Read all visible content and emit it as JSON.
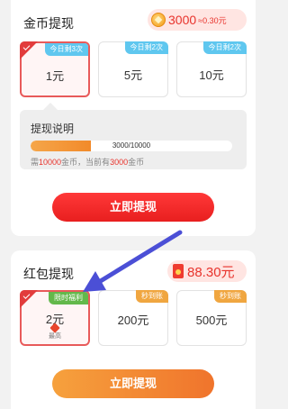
{
  "coin_section": {
    "title": "金币提现",
    "balance": "3000",
    "balance_sub": "≈0.30元",
    "options": [
      {
        "badge": "今日剩3次",
        "value": "1元",
        "selected": true
      },
      {
        "badge": "今日剩2次",
        "value": "5元",
        "selected": false
      },
      {
        "badge": "今日剩2次",
        "value": "10元",
        "selected": false
      }
    ],
    "explain": {
      "title": "提现说明",
      "progress_text": "3000/10000",
      "progress_fraction": 0.3,
      "note_prefix": "需",
      "note_need": "10000",
      "note_mid": "金币，当前有",
      "note_have": "3000",
      "note_suffix": "金币"
    },
    "button_label": "立即提现"
  },
  "red_section": {
    "title": "红包提现",
    "balance": "88.30元",
    "options": [
      {
        "badge": "限时福利",
        "value": "2元",
        "sub": "最高",
        "selected": true
      },
      {
        "badge": "秒到账",
        "value": "200元",
        "selected": false
      },
      {
        "badge": "秒到账",
        "value": "500元",
        "selected": false
      }
    ],
    "button_label": "立即提现"
  },
  "colors": {
    "accent_red": "#e8332c",
    "button_red": "#ff3838",
    "button_orange": "#f0742c",
    "annotation_arrow": "#4b4fd6"
  }
}
